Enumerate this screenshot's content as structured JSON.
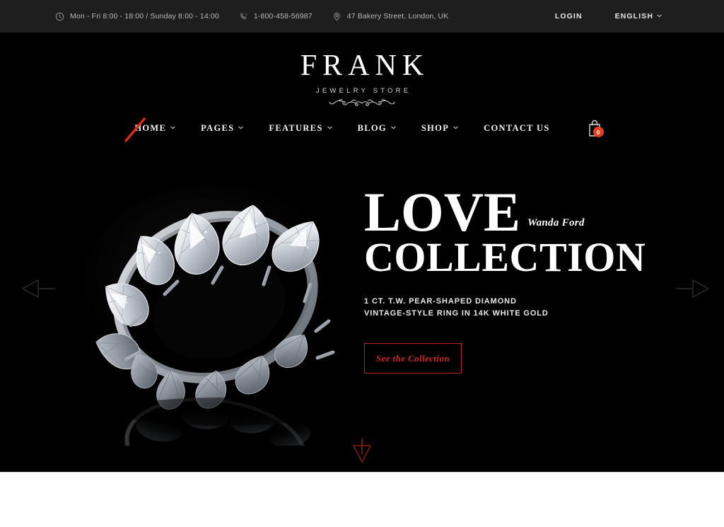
{
  "topbar": {
    "hours": {
      "icon": "clock-icon",
      "text": "Mon - Fri 8:00 - 18:00 / Sunday 8:00 - 14:00"
    },
    "phone": {
      "icon": "phone-icon",
      "text": "1-800-458-56987"
    },
    "address": {
      "icon": "location-pin-icon",
      "text": "47 Bakery Street, London, UK"
    },
    "login_label": "LOGIN",
    "language_label": "ENGLISH",
    "language_caret": "chevron-down-icon",
    "background": "#1e1e1e"
  },
  "logo": {
    "name": "FRANK",
    "tagline": "JEWELRY STORE",
    "ornament": "filigree-flourish-ornament"
  },
  "nav": {
    "items": [
      {
        "label": "HOME",
        "has_caret": true,
        "active": true
      },
      {
        "label": "PAGES",
        "has_caret": true,
        "active": false
      },
      {
        "label": "FEATURES",
        "has_caret": true,
        "active": false
      },
      {
        "label": "BLOG",
        "has_caret": true,
        "active": false
      },
      {
        "label": "SHOP",
        "has_caret": true,
        "active": false
      },
      {
        "label": "CONTACT US",
        "has_caret": false,
        "active": false
      }
    ],
    "cart": {
      "icon": "shopping-bag-icon",
      "count": "0",
      "badge_color": "#e8401f"
    },
    "active_marker": "red-slash-annotation"
  },
  "hero": {
    "title_line1": "LOVE",
    "title_line2": "COLLECTION",
    "author": "Wanda Ford",
    "subtitle_line1": "1 CT. T.W. PEAR-SHAPED DIAMOND",
    "subtitle_line2": "VINTAGE-STYLE RING IN 14K WHITE GOLD",
    "cta_label": "See the Collection",
    "cta_border_color": "#c0201c",
    "cta_text_color": "#d3241f",
    "background": "#000000",
    "product_image": "diamond-eternity-ring-photo"
  },
  "slider": {
    "prev_icon": "arrow-left-icon",
    "next_icon": "arrow-right-icon",
    "scroll_down_icon": "scroll-down-triangle-icon",
    "scroll_down_color": "#8a1a14"
  },
  "colors": {
    "accent_red": "#d3241f",
    "badge_red": "#e8401f",
    "topbar_bg": "#1e1e1e",
    "hero_bg": "#000000",
    "page_bg": "#ffffff"
  }
}
